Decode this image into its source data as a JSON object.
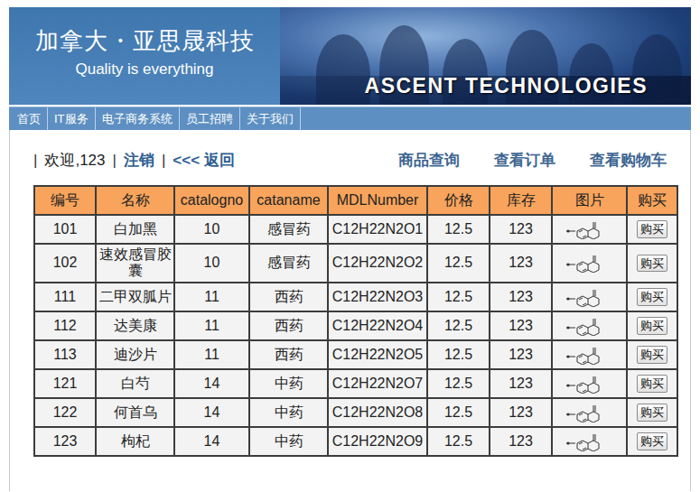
{
  "header": {
    "title": "加拿大・亚思晟科技",
    "slogan": "Quality is everything",
    "banner": "ASCENT TECHNOLOGIES"
  },
  "nav": {
    "items": [
      {
        "label": "首页"
      },
      {
        "label": "IT服务"
      },
      {
        "label": "电子商务系统"
      },
      {
        "label": "员工招聘"
      },
      {
        "label": "关于我们"
      }
    ]
  },
  "toolbar": {
    "left": [
      {
        "text": "|",
        "kind": "sep"
      },
      {
        "text": "欢迎,123",
        "kind": "text"
      },
      {
        "text": "|",
        "kind": "sep"
      },
      {
        "text": "注销",
        "kind": "link"
      },
      {
        "text": "|",
        "kind": "sep"
      },
      {
        "text": "<<< 返回",
        "kind": "link"
      }
    ],
    "right": [
      {
        "label": "商品查询"
      },
      {
        "label": "查看订单"
      },
      {
        "label": "查看购物车"
      }
    ]
  },
  "table": {
    "columns": [
      "编号",
      "名称",
      "catalogno",
      "cataname",
      "MDLNumber",
      "价格",
      "库存",
      "图片",
      "购买"
    ],
    "rows": [
      {
        "cells": [
          "101",
          "白加黑",
          "10",
          "感冒药",
          "C12H22N2O1",
          "12.5",
          "123"
        ],
        "button": "购买"
      },
      {
        "cells": [
          "102",
          "速效感冒胶囊",
          "10",
          "感冒药",
          "C12H22N2O2",
          "12.5",
          "123"
        ],
        "button": "购买"
      },
      {
        "cells": [
          "111",
          "二甲双胍片",
          "11",
          "西药",
          "C12H22N2O3",
          "12.5",
          "123"
        ],
        "button": "购买"
      },
      {
        "cells": [
          "112",
          "达美康",
          "11",
          "西药",
          "C12H22N2O4",
          "12.5",
          "123"
        ],
        "button": "购买"
      },
      {
        "cells": [
          "113",
          "迪沙片",
          "11",
          "西药",
          "C12H22N2O5",
          "12.5",
          "123"
        ],
        "button": "购买"
      },
      {
        "cells": [
          "121",
          "白芍",
          "14",
          "中药",
          "C12H22N2O7",
          "12.5",
          "123"
        ],
        "button": "购买"
      },
      {
        "cells": [
          "122",
          "何首乌",
          "14",
          "中药",
          "C12H22N2O8",
          "12.5",
          "123"
        ],
        "button": "购买"
      },
      {
        "cells": [
          "123",
          "枸杞",
          "14",
          "中药",
          "C12H22N2O9",
          "12.5",
          "123"
        ],
        "button": "购买"
      }
    ]
  }
}
